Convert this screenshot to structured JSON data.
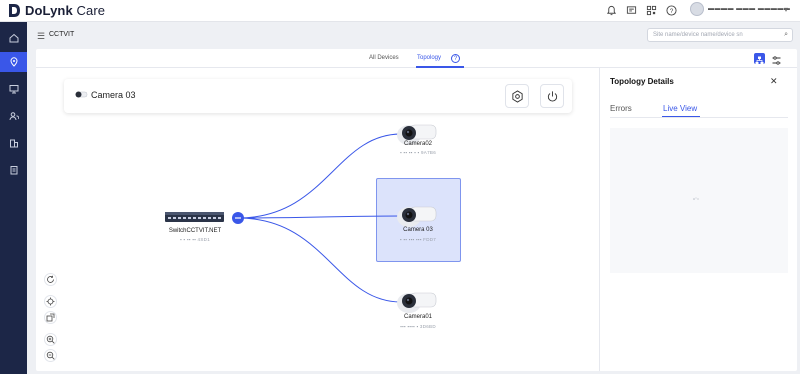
{
  "app": {
    "brand_bold": "DoLynk",
    "brand_light": "Care",
    "user_name": "▬▬▬▬ ▬▬▬ ▬▬▬▬▬"
  },
  "colors": {
    "accent": "#3a57e8",
    "sidebar": "#1c2647",
    "link_line": "#3a57e8"
  },
  "subbar": {
    "breadcrumb": "CCTVIT",
    "search_placeholder": "Site name/device name/device sn"
  },
  "tabs": {
    "all_devices": "All Devices",
    "topology": "Topology",
    "help": "?"
  },
  "selected_card": {
    "title": "Camera 03"
  },
  "topology": {
    "switch": {
      "name": "SwitchCCTVIT.NET",
      "sub": "▪  ▪  ▪▪  ▪▪ 4SD1"
    },
    "cameras": [
      {
        "name": "Camera02",
        "sub": "▪  ▪▪  ▪▪ ▪  ▪ 9A7B6"
      },
      {
        "name": "Camera 03",
        "sub": "▪ ▪▪ ▪▪▪ ▪▪▪ FDD7"
      },
      {
        "name": "Camera01",
        "sub": "▪▪▪ ▪▪▪▪ ▪ 3D6BD"
      }
    ]
  },
  "details": {
    "title": "Topology Details",
    "tab_errors": "Errors",
    "tab_live_view": "Live View",
    "close": "✕"
  }
}
